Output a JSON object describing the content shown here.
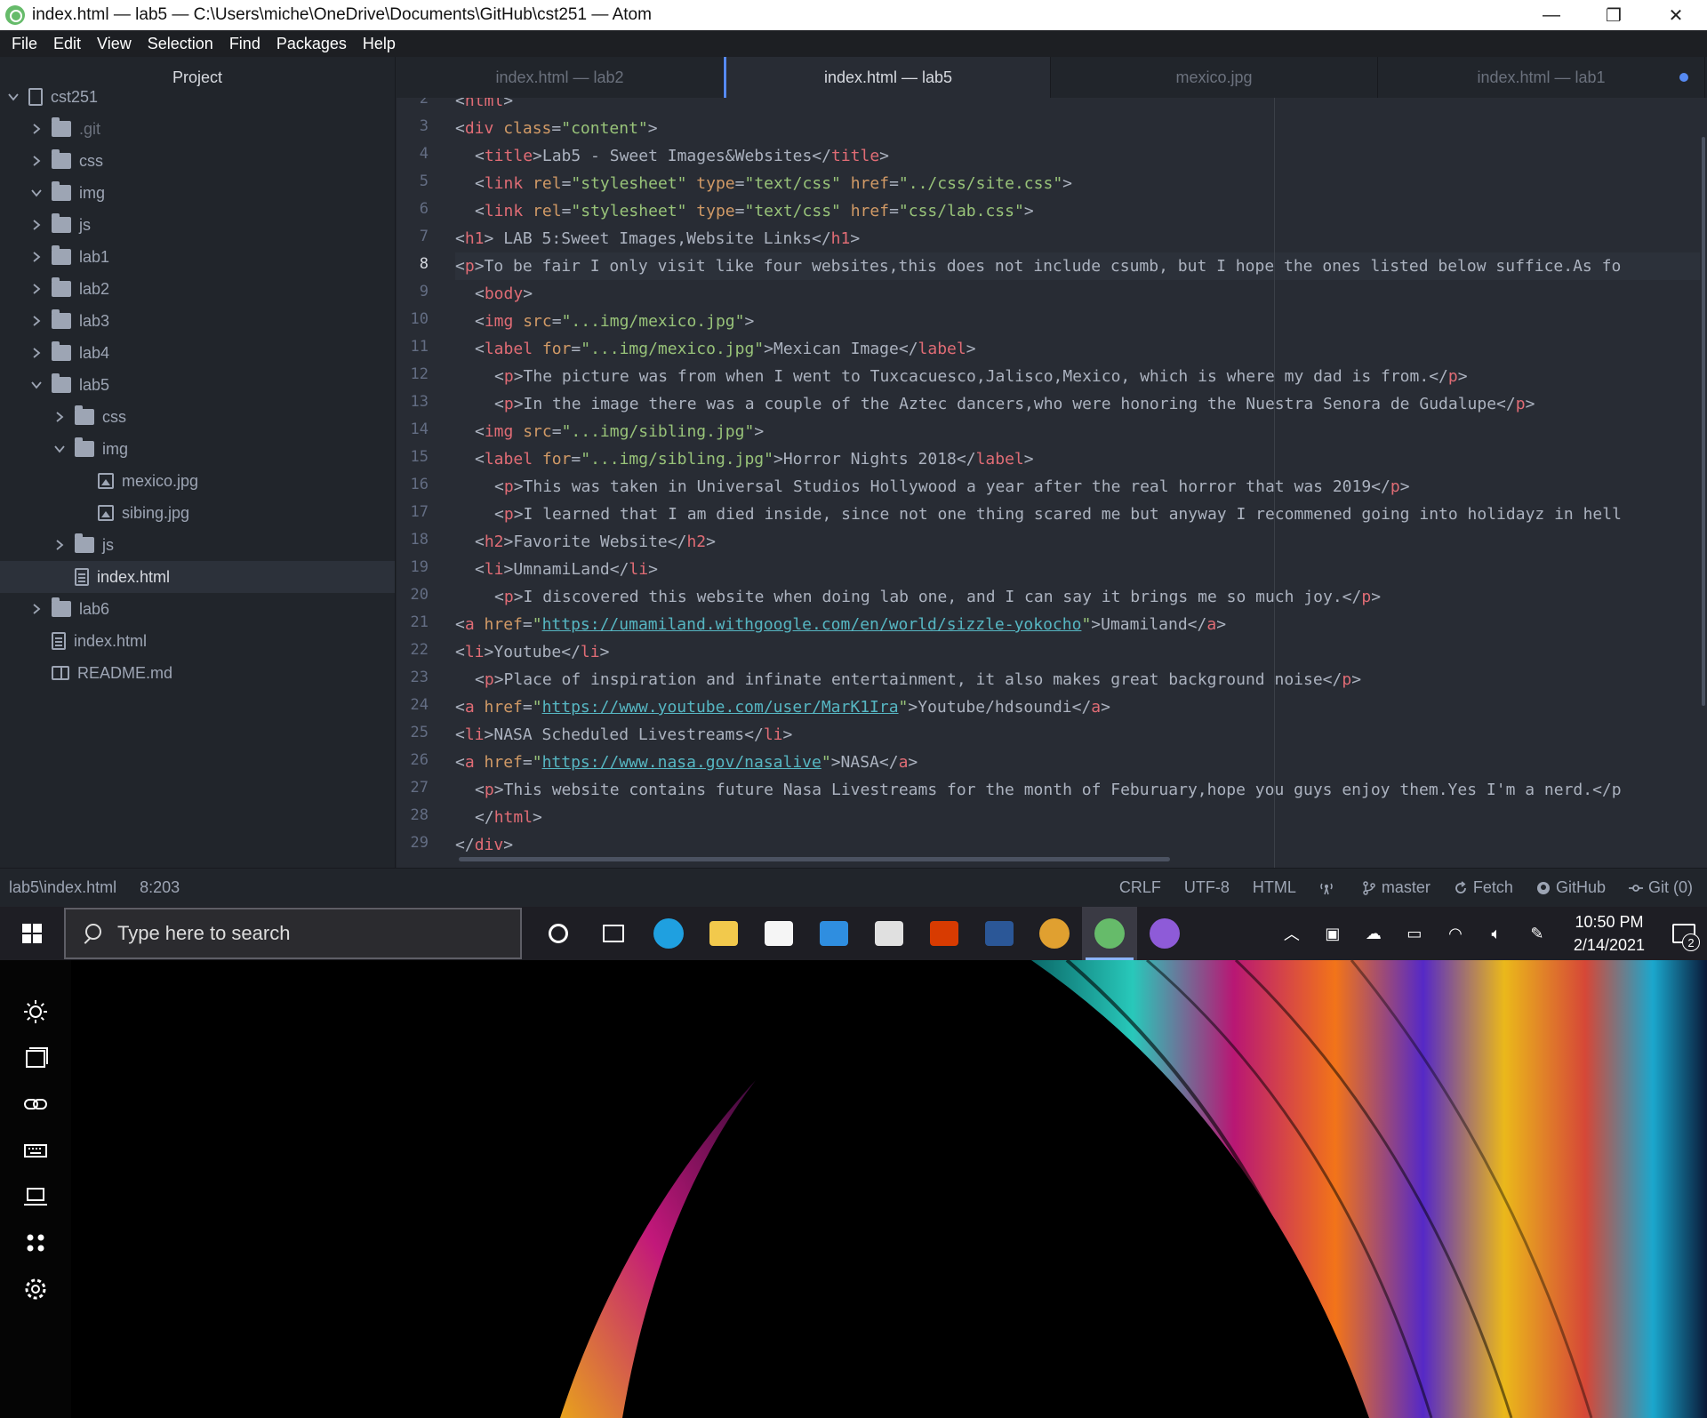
{
  "window": {
    "title": "index.html — lab5 — C:\\Users\\miche\\OneDrive\\Documents\\GitHub\\cst251 — Atom",
    "minimize": "—",
    "maximize": "❐",
    "close": "✕"
  },
  "menu": [
    "File",
    "Edit",
    "View",
    "Selection",
    "Find",
    "Packages",
    "Help"
  ],
  "tree": {
    "title": "Project",
    "root": "cst251",
    "items": [
      {
        "label": ".git",
        "type": "folder",
        "expanded": false,
        "depth": 1,
        "dim": true
      },
      {
        "label": "css",
        "type": "folder",
        "expanded": false,
        "depth": 1
      },
      {
        "label": "img",
        "type": "folder",
        "expanded": true,
        "depth": 1
      },
      {
        "label": "js",
        "type": "folder",
        "expanded": false,
        "depth": 1
      },
      {
        "label": "lab1",
        "type": "folder",
        "expanded": false,
        "depth": 1
      },
      {
        "label": "lab2",
        "type": "folder",
        "expanded": false,
        "depth": 1
      },
      {
        "label": "lab3",
        "type": "folder",
        "expanded": false,
        "depth": 1
      },
      {
        "label": "lab4",
        "type": "folder",
        "expanded": false,
        "depth": 1
      },
      {
        "label": "lab5",
        "type": "folder",
        "expanded": true,
        "depth": 1
      },
      {
        "label": "css",
        "type": "folder",
        "expanded": false,
        "depth": 2
      },
      {
        "label": "img",
        "type": "folder",
        "expanded": true,
        "depth": 2
      },
      {
        "label": "mexico.jpg",
        "type": "image",
        "depth": 3
      },
      {
        "label": "sibing.jpg",
        "type": "image",
        "depth": 3
      },
      {
        "label": "js",
        "type": "folder",
        "expanded": false,
        "depth": 2
      },
      {
        "label": "index.html",
        "type": "file",
        "depth": 2,
        "selected": true
      },
      {
        "label": "lab6",
        "type": "folder",
        "expanded": false,
        "depth": 1
      },
      {
        "label": "index.html",
        "type": "file",
        "depth": 1
      },
      {
        "label": "README.md",
        "type": "book",
        "depth": 1
      }
    ]
  },
  "tabs": [
    {
      "label": "index.html — lab2",
      "active": false,
      "modified": false
    },
    {
      "label": "index.html — lab5",
      "active": true,
      "modified": false
    },
    {
      "label": "mexico.jpg",
      "active": false,
      "modified": false
    },
    {
      "label": "index.html — lab1",
      "active": false,
      "modified": true
    }
  ],
  "editor": {
    "current_line": 8,
    "lines": [
      {
        "n": 2,
        "indent": 0,
        "segs": [
          [
            "t",
            "<"
          ],
          [
            "tag",
            "html"
          ],
          [
            "t",
            ">"
          ]
        ]
      },
      {
        "n": 3,
        "indent": 0,
        "segs": [
          [
            "t",
            "<"
          ],
          [
            "tag",
            "div"
          ],
          [
            "t",
            " "
          ],
          [
            "attr",
            "class"
          ],
          [
            "t",
            "="
          ],
          [
            "str",
            "\"content\""
          ],
          [
            "t",
            ">"
          ]
        ]
      },
      {
        "n": 4,
        "indent": 2,
        "segs": [
          [
            "t",
            "<"
          ],
          [
            "tag",
            "title"
          ],
          [
            "t",
            ">Lab5 - Sweet Images&Websites</"
          ],
          [
            "tag",
            "title"
          ],
          [
            "t",
            ">"
          ]
        ]
      },
      {
        "n": 5,
        "indent": 2,
        "segs": [
          [
            "t",
            "<"
          ],
          [
            "tag",
            "link"
          ],
          [
            "t",
            " "
          ],
          [
            "attr",
            "rel"
          ],
          [
            "t",
            "="
          ],
          [
            "str",
            "\"stylesheet\""
          ],
          [
            "t",
            " "
          ],
          [
            "attr",
            "type"
          ],
          [
            "t",
            "="
          ],
          [
            "str",
            "\"text/css\""
          ],
          [
            "t",
            " "
          ],
          [
            "attr",
            "href"
          ],
          [
            "t",
            "="
          ],
          [
            "str",
            "\"../css/site.css\""
          ],
          [
            "t",
            ">"
          ]
        ]
      },
      {
        "n": 6,
        "indent": 2,
        "segs": [
          [
            "t",
            "<"
          ],
          [
            "tag",
            "link"
          ],
          [
            "t",
            " "
          ],
          [
            "attr",
            "rel"
          ],
          [
            "t",
            "="
          ],
          [
            "str",
            "\"stylesheet\""
          ],
          [
            "t",
            " "
          ],
          [
            "attr",
            "type"
          ],
          [
            "t",
            "="
          ],
          [
            "str",
            "\"text/css\""
          ],
          [
            "t",
            " "
          ],
          [
            "attr",
            "href"
          ],
          [
            "t",
            "="
          ],
          [
            "str",
            "\"css/lab.css\""
          ],
          [
            "t",
            ">"
          ]
        ]
      },
      {
        "n": 7,
        "indent": 0,
        "segs": [
          [
            "t",
            "<"
          ],
          [
            "tag",
            "h1"
          ],
          [
            "t",
            "> LAB 5:Sweet Images,Website Links</"
          ],
          [
            "tag",
            "h1"
          ],
          [
            "t",
            ">"
          ]
        ]
      },
      {
        "n": 8,
        "indent": 0,
        "segs": [
          [
            "t",
            "<"
          ],
          [
            "tag",
            "p"
          ],
          [
            "t",
            ">To be fair I only visit like four websites,this does not include csumb, but I hope the ones listed below suffice.As fo"
          ]
        ]
      },
      {
        "n": 9,
        "indent": 2,
        "segs": [
          [
            "t",
            "<"
          ],
          [
            "tag",
            "body"
          ],
          [
            "t",
            ">"
          ]
        ]
      },
      {
        "n": 10,
        "indent": 2,
        "segs": [
          [
            "t",
            "<"
          ],
          [
            "tag",
            "img"
          ],
          [
            "t",
            " "
          ],
          [
            "attr",
            "src"
          ],
          [
            "t",
            "="
          ],
          [
            "str",
            "\"...img/mexico.jpg\""
          ],
          [
            "t",
            ">"
          ]
        ]
      },
      {
        "n": 11,
        "indent": 2,
        "segs": [
          [
            "t",
            "<"
          ],
          [
            "tag",
            "label"
          ],
          [
            "t",
            " "
          ],
          [
            "attr",
            "for"
          ],
          [
            "t",
            "="
          ],
          [
            "str",
            "\"...img/mexico.jpg\""
          ],
          [
            "t",
            ">Mexican Image</"
          ],
          [
            "tag",
            "label"
          ],
          [
            "t",
            ">"
          ]
        ]
      },
      {
        "n": 12,
        "indent": 4,
        "segs": [
          [
            "t",
            "<"
          ],
          [
            "tag",
            "p"
          ],
          [
            "t",
            ">The picture was from when I went to Tuxcacuesco,Jalisco,Mexico, which is where my dad is from.</"
          ],
          [
            "tag",
            "p"
          ],
          [
            "t",
            ">"
          ]
        ]
      },
      {
        "n": 13,
        "indent": 4,
        "segs": [
          [
            "t",
            "<"
          ],
          [
            "tag",
            "p"
          ],
          [
            "t",
            ">In the image there was a couple of the Aztec dancers,who were honoring the Nuestra Senora de Gudalupe</"
          ],
          [
            "tag",
            "p"
          ],
          [
            "t",
            ">"
          ]
        ]
      },
      {
        "n": 14,
        "indent": 2,
        "segs": [
          [
            "t",
            "<"
          ],
          [
            "tag",
            "img"
          ],
          [
            "t",
            " "
          ],
          [
            "attr",
            "src"
          ],
          [
            "t",
            "="
          ],
          [
            "str",
            "\"...img/sibling.jpg\""
          ],
          [
            "t",
            ">"
          ]
        ]
      },
      {
        "n": 15,
        "indent": 2,
        "segs": [
          [
            "t",
            "<"
          ],
          [
            "tag",
            "label"
          ],
          [
            "t",
            " "
          ],
          [
            "attr",
            "for"
          ],
          [
            "t",
            "="
          ],
          [
            "str",
            "\"...img/sibling.jpg\""
          ],
          [
            "t",
            ">Horror Nights 2018</"
          ],
          [
            "tag",
            "label"
          ],
          [
            "t",
            ">"
          ]
        ]
      },
      {
        "n": 16,
        "indent": 4,
        "segs": [
          [
            "t",
            "<"
          ],
          [
            "tag",
            "p"
          ],
          [
            "t",
            ">This was taken in Universal Studios Hollywood a year after the real horror that was 2019</"
          ],
          [
            "tag",
            "p"
          ],
          [
            "t",
            ">"
          ]
        ]
      },
      {
        "n": 17,
        "indent": 4,
        "segs": [
          [
            "t",
            "<"
          ],
          [
            "tag",
            "p"
          ],
          [
            "t",
            ">I learned that I am died inside, since not one thing scared me but anyway I recommened going into holidayz in hell"
          ]
        ]
      },
      {
        "n": 18,
        "indent": 2,
        "segs": [
          [
            "t",
            "<"
          ],
          [
            "tag",
            "h2"
          ],
          [
            "t",
            ">Favorite Website</"
          ],
          [
            "tag",
            "h2"
          ],
          [
            "t",
            ">"
          ]
        ]
      },
      {
        "n": 19,
        "indent": 2,
        "segs": [
          [
            "t",
            "<"
          ],
          [
            "tag",
            "li"
          ],
          [
            "t",
            ">UmnamiLand</"
          ],
          [
            "tag",
            "li"
          ],
          [
            "t",
            ">"
          ]
        ]
      },
      {
        "n": 20,
        "indent": 4,
        "segs": [
          [
            "t",
            "<"
          ],
          [
            "tag",
            "p"
          ],
          [
            "t",
            ">I discovered this website when doing lab one, and I can say it brings me so much joy.</"
          ],
          [
            "tag",
            "p"
          ],
          [
            "t",
            ">"
          ]
        ]
      },
      {
        "n": 21,
        "indent": 0,
        "segs": [
          [
            "t",
            "<"
          ],
          [
            "tag",
            "a"
          ],
          [
            "t",
            " "
          ],
          [
            "attr",
            "href"
          ],
          [
            "t",
            "="
          ],
          [
            "str",
            "\""
          ],
          [
            "link",
            "https://umamiland.withgoogle.com/en/world/sizzle-yokocho"
          ],
          [
            "str",
            "\""
          ],
          [
            "t",
            ">Umamiland</"
          ],
          [
            "tag",
            "a"
          ],
          [
            "t",
            ">"
          ]
        ]
      },
      {
        "n": 22,
        "indent": 0,
        "segs": [
          [
            "t",
            "<"
          ],
          [
            "tag",
            "li"
          ],
          [
            "t",
            ">Youtube</"
          ],
          [
            "tag",
            "li"
          ],
          [
            "t",
            ">"
          ]
        ]
      },
      {
        "n": 23,
        "indent": 2,
        "segs": [
          [
            "t",
            "<"
          ],
          [
            "tag",
            "p"
          ],
          [
            "t",
            ">Place of inspiration and infinate entertainment, it also makes great background noise</"
          ],
          [
            "tag",
            "p"
          ],
          [
            "t",
            ">"
          ]
        ]
      },
      {
        "n": 24,
        "indent": 0,
        "segs": [
          [
            "t",
            "<"
          ],
          [
            "tag",
            "a"
          ],
          [
            "t",
            " "
          ],
          [
            "attr",
            "href"
          ],
          [
            "t",
            "="
          ],
          [
            "str",
            "\""
          ],
          [
            "link",
            "https://www.youtube.com/user/MarK1Ira"
          ],
          [
            "str",
            "\""
          ],
          [
            "t",
            ">Youtube/hdsoundi</"
          ],
          [
            "tag",
            "a"
          ],
          [
            "t",
            ">"
          ]
        ]
      },
      {
        "n": 25,
        "indent": 0,
        "segs": [
          [
            "t",
            "<"
          ],
          [
            "tag",
            "li"
          ],
          [
            "t",
            ">NASA Scheduled Livestreams</"
          ],
          [
            "tag",
            "li"
          ],
          [
            "t",
            ">"
          ]
        ]
      },
      {
        "n": 26,
        "indent": 0,
        "segs": [
          [
            "t",
            "<"
          ],
          [
            "tag",
            "a"
          ],
          [
            "t",
            " "
          ],
          [
            "attr",
            "href"
          ],
          [
            "t",
            "="
          ],
          [
            "str",
            "\""
          ],
          [
            "link",
            "https://www.nasa.gov/nasalive"
          ],
          [
            "str",
            "\""
          ],
          [
            "t",
            ">NASA</"
          ],
          [
            "tag",
            "a"
          ],
          [
            "t",
            ">"
          ]
        ]
      },
      {
        "n": 27,
        "indent": 2,
        "segs": [
          [
            "t",
            "<"
          ],
          [
            "tag",
            "p"
          ],
          [
            "t",
            ">This website contains future Nasa Livestreams for the month of Feburuary,hope you guys enjoy them.Yes I'm a nerd.</p"
          ]
        ]
      },
      {
        "n": 28,
        "indent": 2,
        "segs": [
          [
            "t",
            "</"
          ],
          [
            "tag",
            "html"
          ],
          [
            "t",
            ">"
          ]
        ]
      },
      {
        "n": 29,
        "indent": 0,
        "segs": [
          [
            "t",
            "</"
          ],
          [
            "tag",
            "div"
          ],
          [
            "t",
            ">"
          ]
        ]
      }
    ]
  },
  "status": {
    "path": "lab5\\index.html",
    "cursor": "8:203",
    "line_ending": "CRLF",
    "encoding": "UTF-8",
    "grammar": "HTML",
    "branch": "master",
    "fetch": "Fetch",
    "github": "GitHub",
    "git": "Git (0)"
  },
  "taskbar": {
    "search_placeholder": "Type here to search",
    "apps": [
      {
        "name": "cortana",
        "color": "#ffffff"
      },
      {
        "name": "task-view",
        "color": "#ffffff"
      },
      {
        "name": "edge",
        "color": "#1fa0e0"
      },
      {
        "name": "file-explorer",
        "color": "#f2c94c"
      },
      {
        "name": "store",
        "color": "#f5f5f5"
      },
      {
        "name": "mail",
        "color": "#2f8ee0"
      },
      {
        "name": "myasus",
        "color": "#e0e0e0"
      },
      {
        "name": "office",
        "color": "#d83b01"
      },
      {
        "name": "word",
        "color": "#2b5797"
      },
      {
        "name": "chrome",
        "color": "#e0a030"
      },
      {
        "name": "atom",
        "color": "#66bb6a"
      },
      {
        "name": "github-desktop",
        "color": "#8e5bd8"
      }
    ],
    "time": "10:50 PM",
    "date": "2/14/2021",
    "notification_count": "2"
  }
}
